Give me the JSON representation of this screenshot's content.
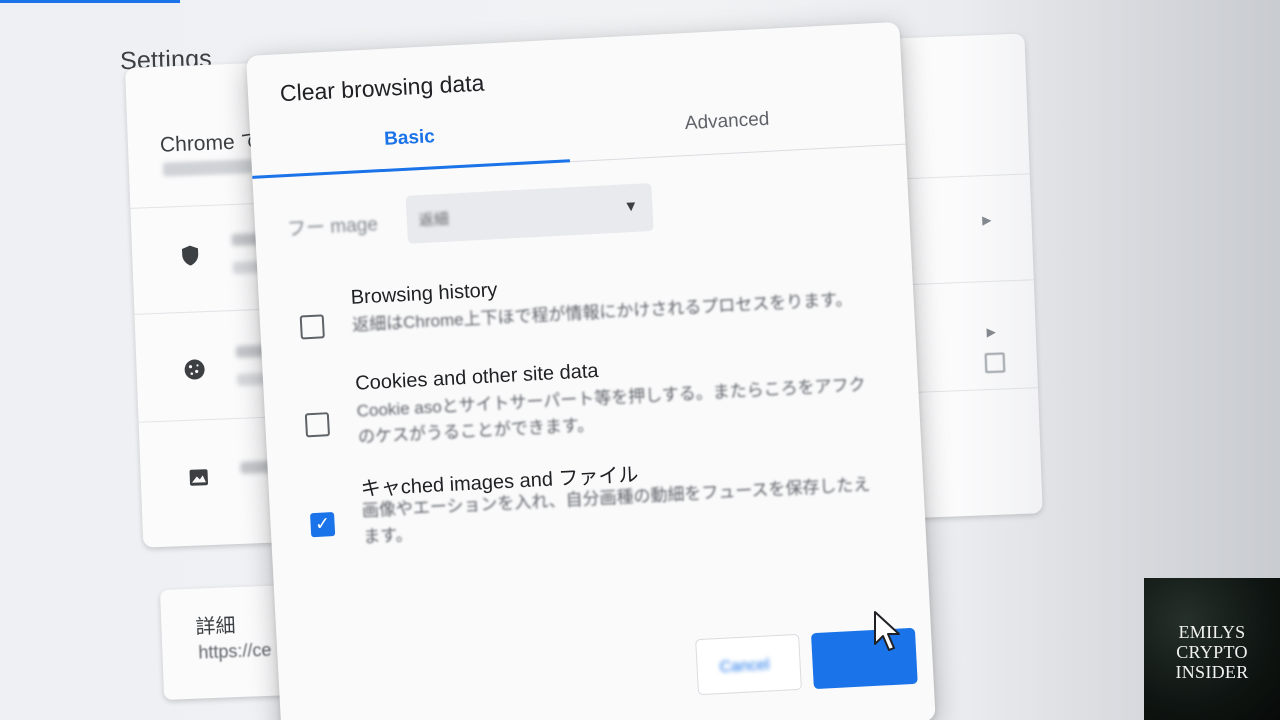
{
  "page": {
    "settings_title": "Settings"
  },
  "background_card": {
    "heading": "Chrome で",
    "card2_title": "詳細",
    "card2_url": "https://ce"
  },
  "dialog": {
    "title": "Clear browsing data",
    "tabs": [
      {
        "label": "Basic",
        "active": true
      },
      {
        "label": "Advanced",
        "active": false
      }
    ],
    "time_range": {
      "label": "フー mage",
      "value": "返細"
    },
    "options": [
      {
        "title": "Browsing history",
        "description": "返細はChrome上下ほで程が情報にかけされるプロセスをります。",
        "checked": false
      },
      {
        "title": "Cookies and other site data",
        "description": "Cookie asoとサイトサーパート等を押しする。またらころをアフクのケスがうることができます。",
        "checked": false
      },
      {
        "title": "キャched images and ファイル",
        "description": "画像やエーションを入れ、自分画種の動細をフュースを保存したえます。",
        "checked": true
      }
    ],
    "cancel_label": "Cancel",
    "check_glyph": "✓",
    "caret_glyph": "▼"
  },
  "watermark": {
    "line1": "EMILYS",
    "line2": "CRYPTO",
    "line3": "INSIDER"
  },
  "colors": {
    "accent": "#1a73e8",
    "text_primary": "#202124",
    "text_secondary": "#5f6368"
  }
}
